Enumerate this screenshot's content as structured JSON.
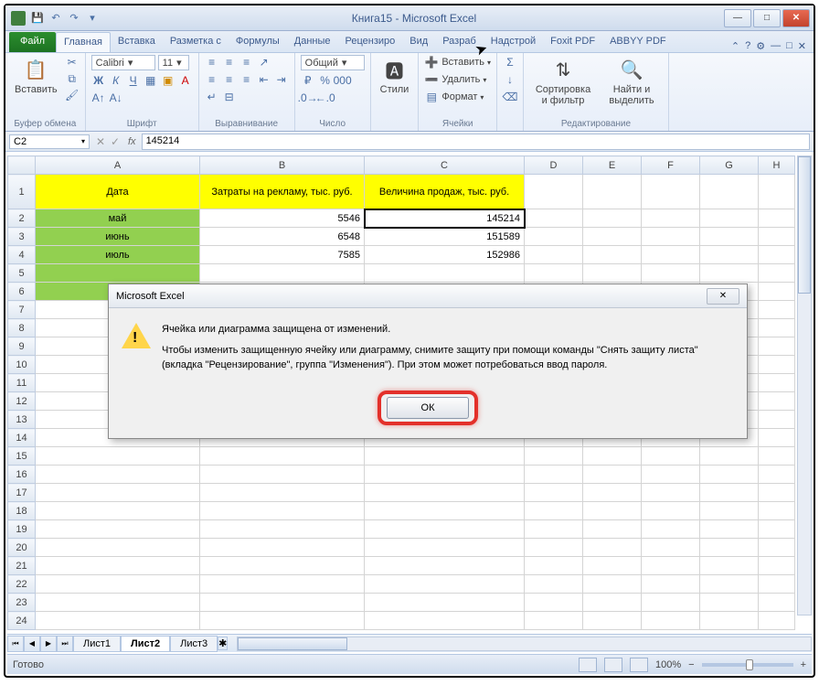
{
  "window": {
    "title": "Книга15  -  Microsoft Excel"
  },
  "tabs": {
    "file": "Файл",
    "list": [
      "Главная",
      "Вставка",
      "Разметка с",
      "Формулы",
      "Данные",
      "Рецензиро",
      "Вид",
      "Разраб",
      "Надстрой",
      "Foxit PDF",
      "ABBYY PDF"
    ],
    "active_index": 0
  },
  "ribbon": {
    "paste": "Вставить",
    "clipboard": "Буфер обмена",
    "font_name": "Calibri",
    "font_size": "11",
    "font_group": "Шрифт",
    "align_group": "Выравнивание",
    "number_format": "Общий",
    "number_group": "Число",
    "styles": "Стили",
    "insert": "Вставить",
    "delete": "Удалить",
    "format": "Формат",
    "cells_group": "Ячейки",
    "sort": "Сортировка и фильтр",
    "find": "Найти и выделить",
    "edit_group": "Редактирование"
  },
  "formula": {
    "name_box": "C2",
    "fx": "fx",
    "value": "145214"
  },
  "columns": [
    "A",
    "B",
    "C",
    "D",
    "E",
    "F",
    "G",
    "H"
  ],
  "headers": {
    "A": "Дата",
    "B": "Затраты на рекламу, тыс. руб.",
    "C": "Величина продаж, тыс. руб."
  },
  "rows": [
    {
      "n": 1
    },
    {
      "n": 2,
      "A": "май",
      "B": "5546",
      "C": "145214",
      "sel": true
    },
    {
      "n": 3,
      "A": "июнь",
      "B": "6548",
      "C": "151589"
    },
    {
      "n": 4,
      "A": "июль",
      "B": "7585",
      "C": "152986"
    },
    {
      "n": 5
    },
    {
      "n": 6
    },
    {
      "n": 7
    },
    {
      "n": 8
    },
    {
      "n": 9
    },
    {
      "n": 10
    },
    {
      "n": 11
    },
    {
      "n": 12
    },
    {
      "n": 13
    },
    {
      "n": 14
    },
    {
      "n": 15
    },
    {
      "n": 16
    },
    {
      "n": 17
    },
    {
      "n": 18
    },
    {
      "n": 19
    },
    {
      "n": 20
    },
    {
      "n": 21
    },
    {
      "n": 22
    },
    {
      "n": 23
    },
    {
      "n": 24
    }
  ],
  "sheets": {
    "list": [
      "Лист1",
      "Лист2",
      "Лист3"
    ],
    "active_index": 1
  },
  "status": {
    "ready": "Готово",
    "zoom": "100%"
  },
  "dialog": {
    "title": "Microsoft Excel",
    "line1": "Ячейка или диаграмма защищена от изменений.",
    "line2": "Чтобы изменить защищенную ячейку или диаграмму, снимите защиту при помощи команды \"Снять защиту листа\" (вкладка \"Рецензирование\", группа \"Изменения\"). При этом может потребоваться ввод пароля.",
    "ok": "ОК"
  },
  "col_widths": {
    "row_hdr": 30,
    "A": 180,
    "B": 180,
    "C": 175,
    "D": 64,
    "E": 64,
    "F": 64,
    "G": 64,
    "H": 40
  }
}
